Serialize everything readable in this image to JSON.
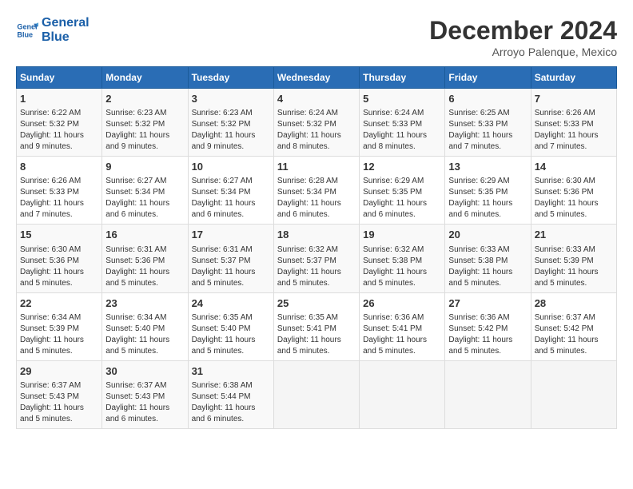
{
  "logo": {
    "line1": "General",
    "line2": "Blue"
  },
  "title": "December 2024",
  "subtitle": "Arroyo Palenque, Mexico",
  "headers": [
    "Sunday",
    "Monday",
    "Tuesday",
    "Wednesday",
    "Thursday",
    "Friday",
    "Saturday"
  ],
  "weeks": [
    [
      {
        "day": "1",
        "sunrise": "6:22 AM",
        "sunset": "5:32 PM",
        "daylight": "11 hours and 9 minutes."
      },
      {
        "day": "2",
        "sunrise": "6:23 AM",
        "sunset": "5:32 PM",
        "daylight": "11 hours and 9 minutes."
      },
      {
        "day": "3",
        "sunrise": "6:23 AM",
        "sunset": "5:32 PM",
        "daylight": "11 hours and 9 minutes."
      },
      {
        "day": "4",
        "sunrise": "6:24 AM",
        "sunset": "5:32 PM",
        "daylight": "11 hours and 8 minutes."
      },
      {
        "day": "5",
        "sunrise": "6:24 AM",
        "sunset": "5:33 PM",
        "daylight": "11 hours and 8 minutes."
      },
      {
        "day": "6",
        "sunrise": "6:25 AM",
        "sunset": "5:33 PM",
        "daylight": "11 hours and 7 minutes."
      },
      {
        "day": "7",
        "sunrise": "6:26 AM",
        "sunset": "5:33 PM",
        "daylight": "11 hours and 7 minutes."
      }
    ],
    [
      {
        "day": "8",
        "sunrise": "6:26 AM",
        "sunset": "5:33 PM",
        "daylight": "11 hours and 7 minutes."
      },
      {
        "day": "9",
        "sunrise": "6:27 AM",
        "sunset": "5:34 PM",
        "daylight": "11 hours and 6 minutes."
      },
      {
        "day": "10",
        "sunrise": "6:27 AM",
        "sunset": "5:34 PM",
        "daylight": "11 hours and 6 minutes."
      },
      {
        "day": "11",
        "sunrise": "6:28 AM",
        "sunset": "5:34 PM",
        "daylight": "11 hours and 6 minutes."
      },
      {
        "day": "12",
        "sunrise": "6:29 AM",
        "sunset": "5:35 PM",
        "daylight": "11 hours and 6 minutes."
      },
      {
        "day": "13",
        "sunrise": "6:29 AM",
        "sunset": "5:35 PM",
        "daylight": "11 hours and 6 minutes."
      },
      {
        "day": "14",
        "sunrise": "6:30 AM",
        "sunset": "5:36 PM",
        "daylight": "11 hours and 5 minutes."
      }
    ],
    [
      {
        "day": "15",
        "sunrise": "6:30 AM",
        "sunset": "5:36 PM",
        "daylight": "11 hours and 5 minutes."
      },
      {
        "day": "16",
        "sunrise": "6:31 AM",
        "sunset": "5:36 PM",
        "daylight": "11 hours and 5 minutes."
      },
      {
        "day": "17",
        "sunrise": "6:31 AM",
        "sunset": "5:37 PM",
        "daylight": "11 hours and 5 minutes."
      },
      {
        "day": "18",
        "sunrise": "6:32 AM",
        "sunset": "5:37 PM",
        "daylight": "11 hours and 5 minutes."
      },
      {
        "day": "19",
        "sunrise": "6:32 AM",
        "sunset": "5:38 PM",
        "daylight": "11 hours and 5 minutes."
      },
      {
        "day": "20",
        "sunrise": "6:33 AM",
        "sunset": "5:38 PM",
        "daylight": "11 hours and 5 minutes."
      },
      {
        "day": "21",
        "sunrise": "6:33 AM",
        "sunset": "5:39 PM",
        "daylight": "11 hours and 5 minutes."
      }
    ],
    [
      {
        "day": "22",
        "sunrise": "6:34 AM",
        "sunset": "5:39 PM",
        "daylight": "11 hours and 5 minutes."
      },
      {
        "day": "23",
        "sunrise": "6:34 AM",
        "sunset": "5:40 PM",
        "daylight": "11 hours and 5 minutes."
      },
      {
        "day": "24",
        "sunrise": "6:35 AM",
        "sunset": "5:40 PM",
        "daylight": "11 hours and 5 minutes."
      },
      {
        "day": "25",
        "sunrise": "6:35 AM",
        "sunset": "5:41 PM",
        "daylight": "11 hours and 5 minutes."
      },
      {
        "day": "26",
        "sunrise": "6:36 AM",
        "sunset": "5:41 PM",
        "daylight": "11 hours and 5 minutes."
      },
      {
        "day": "27",
        "sunrise": "6:36 AM",
        "sunset": "5:42 PM",
        "daylight": "11 hours and 5 minutes."
      },
      {
        "day": "28",
        "sunrise": "6:37 AM",
        "sunset": "5:42 PM",
        "daylight": "11 hours and 5 minutes."
      }
    ],
    [
      {
        "day": "29",
        "sunrise": "6:37 AM",
        "sunset": "5:43 PM",
        "daylight": "11 hours and 5 minutes."
      },
      {
        "day": "30",
        "sunrise": "6:37 AM",
        "sunset": "5:43 PM",
        "daylight": "11 hours and 6 minutes."
      },
      {
        "day": "31",
        "sunrise": "6:38 AM",
        "sunset": "5:44 PM",
        "daylight": "11 hours and 6 minutes."
      },
      null,
      null,
      null,
      null
    ]
  ],
  "labels": {
    "sunrise": "Sunrise:",
    "sunset": "Sunset:",
    "daylight": "Daylight:"
  }
}
